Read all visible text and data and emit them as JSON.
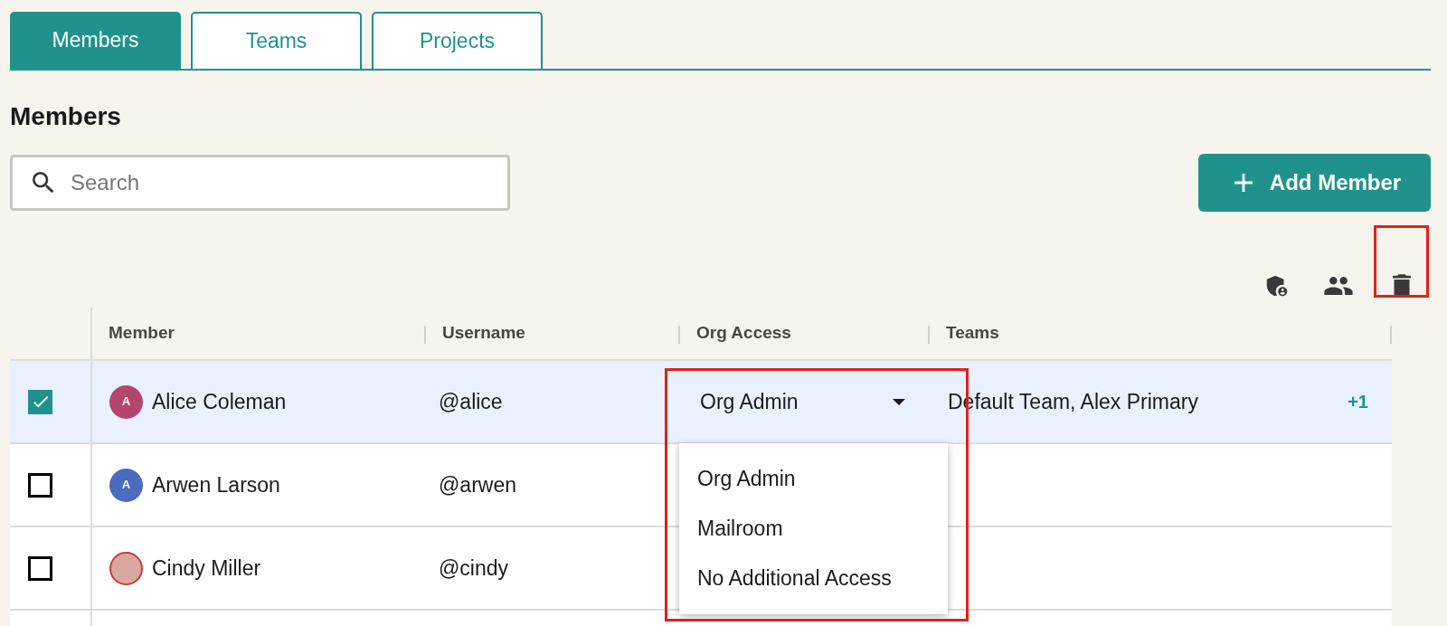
{
  "tabs": [
    {
      "label": "Members",
      "selected": true
    },
    {
      "label": "Teams",
      "selected": false
    },
    {
      "label": "Projects",
      "selected": false
    }
  ],
  "heading": "Members",
  "search": {
    "placeholder": "Search"
  },
  "add_button": {
    "label": "Add Member"
  },
  "table": {
    "columns": [
      "Member",
      "Username",
      "Org Access",
      "Teams"
    ],
    "rows": [
      {
        "checked": true,
        "selected": true,
        "name": "Alice Coleman",
        "avatar": {
          "kind": "initial",
          "initial": "A",
          "color": "#b5446e"
        },
        "username": "@alice",
        "org_access": "Org Admin",
        "teams": "Default Team, Alex Primary",
        "teams_more": "+1"
      },
      {
        "checked": false,
        "selected": false,
        "name": "Arwen Larson",
        "avatar": {
          "kind": "initial",
          "initial": "A",
          "color": "#4a6bbf"
        },
        "username": "@arwen"
      },
      {
        "checked": false,
        "selected": false,
        "name": "Cindy Miller",
        "avatar": {
          "kind": "photo"
        },
        "username": "@cindy"
      }
    ]
  },
  "org_access_menu": {
    "options": [
      {
        "label": "Org Admin",
        "selected": false
      },
      {
        "label": "Mailroom",
        "selected": false
      },
      {
        "label": "No Additional Access",
        "selected": false
      }
    ]
  }
}
